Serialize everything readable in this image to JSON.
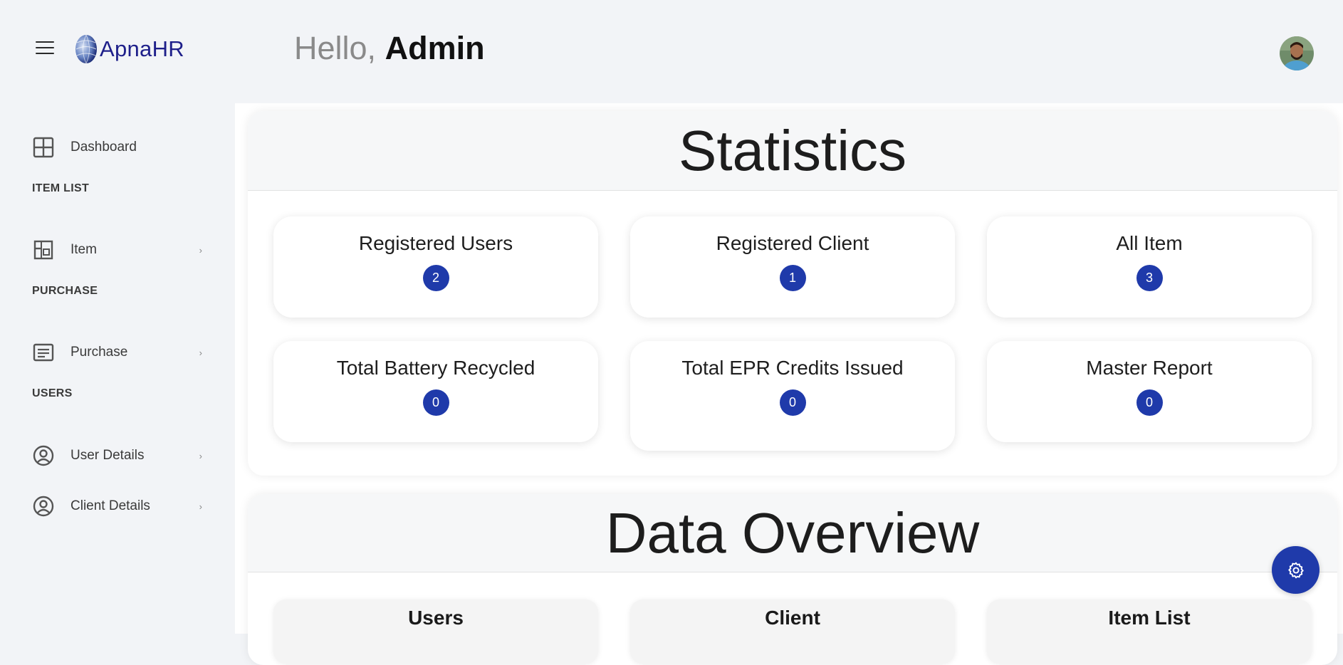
{
  "header": {
    "brand": "ApnaHR",
    "greeting_prefix": "Hello,",
    "user_name": "Admin"
  },
  "sidebar": {
    "dashboard": {
      "label": "Dashboard",
      "icon": "dashboard-grid-icon"
    },
    "sections": [
      {
        "heading": "ITEM LIST",
        "items": [
          {
            "label": "Item",
            "icon": "item-icon"
          }
        ]
      },
      {
        "heading": "PURCHASE",
        "items": [
          {
            "label": "Purchase",
            "icon": "purchase-icon"
          }
        ]
      },
      {
        "heading": "USERS",
        "items": [
          {
            "label": "User Details",
            "icon": "user-circle-icon"
          },
          {
            "label": "Client Details",
            "icon": "user-circle-icon"
          }
        ]
      }
    ]
  },
  "statistics": {
    "title": "Statistics",
    "cards": [
      {
        "label": "Registered Users",
        "count": "2"
      },
      {
        "label": "Registered Client",
        "count": "1"
      },
      {
        "label": "All Item",
        "count": "3"
      },
      {
        "label": "Total Battery Recycled",
        "count": "0"
      },
      {
        "label": "Total EPR Credits Issued",
        "count": "0"
      },
      {
        "label": "Master Report",
        "count": "0"
      }
    ]
  },
  "overview": {
    "title": "Data Overview",
    "cards": [
      {
        "label": "Users"
      },
      {
        "label": "Client"
      },
      {
        "label": "Item List"
      }
    ]
  },
  "colors": {
    "accent": "#1f3aaa",
    "brand_text": "#1e1f8a",
    "page_bg": "#f2f4f7"
  },
  "icons": {
    "menu": "hamburger-icon",
    "settings": "gear-icon",
    "chevron": "chevron-right-icon"
  }
}
